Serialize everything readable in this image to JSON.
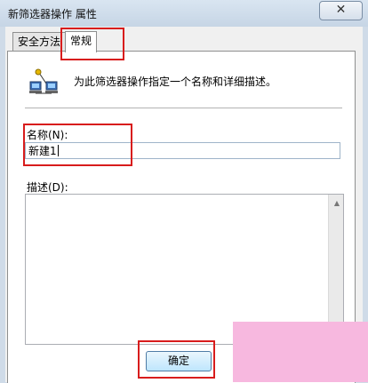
{
  "window": {
    "title": "新筛选器操作 属性",
    "close_glyph": "✕"
  },
  "tabs": [
    {
      "label": "安全方法",
      "active": false
    },
    {
      "label": "常规",
      "active": true
    }
  ],
  "general": {
    "description_text": "为此筛选器操作指定一个名称和详细描述。",
    "name_label": "名称(N):",
    "name_value": "新建1",
    "desc_label": "描述(D):",
    "desc_value": ""
  },
  "buttons": {
    "ok_label": "确定"
  },
  "icons": {
    "network": "network-computers-icon",
    "close": "close-icon",
    "scroll": "scroll-up-arrow-icon"
  },
  "colors": {
    "highlight": "#d81c1c",
    "watermark": "#f7b8df"
  }
}
